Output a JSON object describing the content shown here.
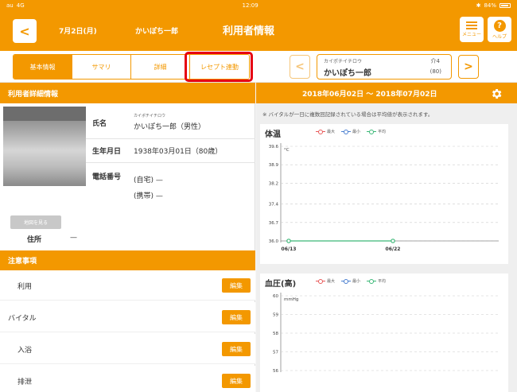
{
  "statusbar": {
    "carrier": "au",
    "network": "4G",
    "time": "12:09",
    "battery": "84%"
  },
  "header": {
    "date": "7月2日(月)",
    "user_name": "かいぽち一郎",
    "title": "利用者情報",
    "menu_label": "メニュー",
    "help_label": "ヘルプ"
  },
  "tabs": [
    {
      "label": "基本情報",
      "active": true
    },
    {
      "label": "サマリ",
      "active": false
    },
    {
      "label": "詳細",
      "active": false
    },
    {
      "label": "レセプト連動",
      "active": false
    }
  ],
  "user_card": {
    "kana": "カイポチイチロウ",
    "care_level": "介4",
    "name": "かいぽち一郎",
    "age": "(80)"
  },
  "detail": {
    "section_title": "利用者詳細情報",
    "name_label": "氏名",
    "name_kana": "カイポチイチロウ",
    "name_value": "かいぽち一郎（男性）",
    "birth_label": "生年月日",
    "birth_value": "1938年03月01日（80歳）",
    "phone_label": "電話番号",
    "phone_home": "(自宅) —",
    "phone_mobile": "(携帯) —",
    "map_button": "地図を見る",
    "address_label": "住所",
    "address_value": "—"
  },
  "notes": {
    "section_title": "注意事項",
    "edit_label": "編集",
    "items": [
      {
        "label": "利用"
      },
      {
        "label": "バイタル"
      },
      {
        "label": "入浴"
      },
      {
        "label": "排泄"
      }
    ]
  },
  "vitals": {
    "range": "2018年06月02日 〜 2018年07月02日",
    "note": "※ バイタルが一日に複数回記録されている場合は平均値が表示されます。",
    "legend": {
      "max": "最大",
      "min": "最小",
      "avg": "平均"
    },
    "colors": {
      "max": "#e85a5a",
      "min": "#4a7fd0",
      "avg": "#3cb878",
      "accent": "#f39800"
    }
  },
  "chart_data": [
    {
      "type": "line",
      "title": "体温",
      "ylabel": "°C",
      "ylim": [
        36.0,
        39.6
      ],
      "yticks": [
        "39.6",
        "38.9",
        "38.2",
        "37.4",
        "36.7",
        "36.0"
      ],
      "categories": [
        "06/13",
        "06/22"
      ],
      "series": [
        {
          "name": "平均",
          "values": [
            36.0,
            36.0
          ]
        }
      ],
      "grid": true,
      "legend": "top"
    },
    {
      "type": "line",
      "title": "血圧(高)",
      "ylabel": "mmHg",
      "ylim": [
        56,
        60
      ],
      "yticks": [
        "60",
        "59",
        "58",
        "57",
        "56"
      ],
      "categories": [],
      "series": [],
      "grid": true,
      "legend": "top"
    }
  ]
}
